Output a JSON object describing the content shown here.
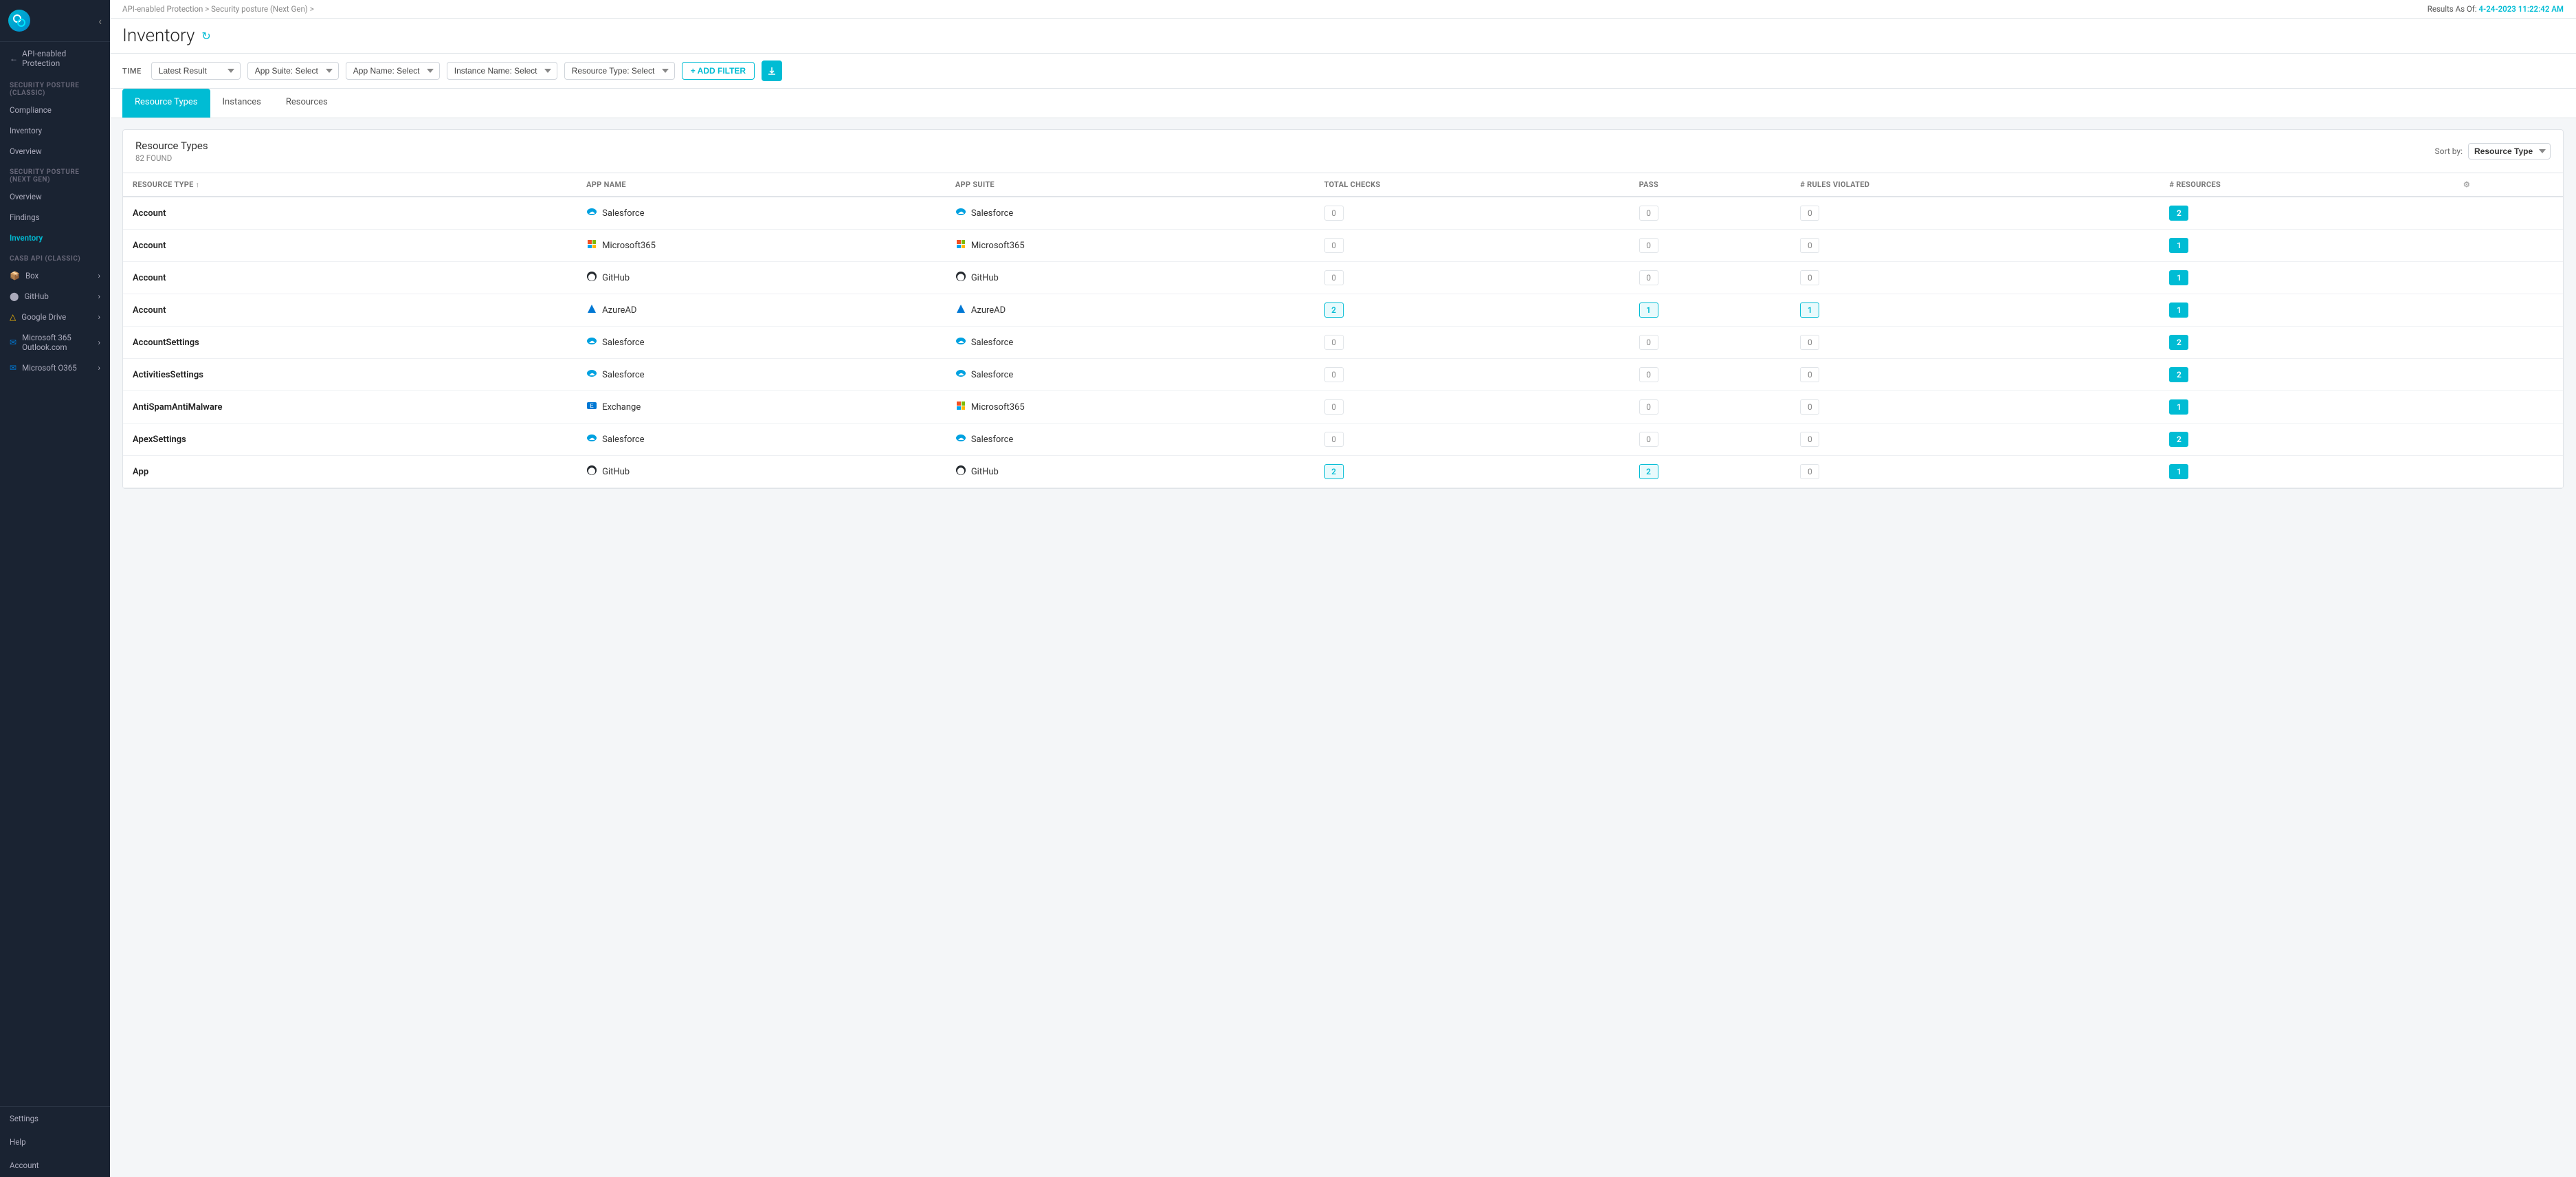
{
  "sidebar": {
    "logo_text": "n",
    "api_protection_title": "API-enabled Protection",
    "back_label": "←",
    "sections": [
      {
        "label": "SECURITY POSTURE (CLASSIC)",
        "items": [
          {
            "id": "compliance",
            "label": "Compliance",
            "active": false
          },
          {
            "id": "inventory-classic",
            "label": "Inventory",
            "active": false
          },
          {
            "id": "overview-classic",
            "label": "Overview",
            "active": false
          }
        ]
      },
      {
        "label": "SECURITY POSTURE (NEXT GEN)",
        "items": [
          {
            "id": "overview-ng",
            "label": "Overview",
            "active": false
          },
          {
            "id": "findings",
            "label": "Findings",
            "active": false
          },
          {
            "id": "inventory-ng",
            "label": "Inventory",
            "active": true
          }
        ]
      },
      {
        "label": "CASB API (CLASSIC)",
        "items": [
          {
            "id": "box",
            "label": "Box",
            "active": false,
            "has_arrow": true
          },
          {
            "id": "github",
            "label": "GitHub",
            "active": false,
            "has_arrow": true
          },
          {
            "id": "google-drive",
            "label": "Google Drive",
            "active": false,
            "has_arrow": true
          },
          {
            "id": "microsoft365-outlook",
            "label": "Microsoft 365 Outlook.com",
            "active": false,
            "has_arrow": true
          },
          {
            "id": "microsoft365",
            "label": "Microsoft O365",
            "active": false,
            "has_arrow": true
          }
        ]
      }
    ],
    "bottom_items": [
      {
        "id": "settings",
        "label": "Settings"
      },
      {
        "id": "help",
        "label": "Help"
      },
      {
        "id": "account",
        "label": "Account"
      }
    ]
  },
  "breadcrumb": {
    "parts": [
      "API-enabled Protection",
      "Security posture (Next Gen)",
      ""
    ]
  },
  "results_as_of": {
    "label": "Results As Of:",
    "value": "4-24-2023 11:22:42 AM"
  },
  "page": {
    "title": "Inventory",
    "time_label": "TIME"
  },
  "filters": {
    "latest_result": {
      "label": "Latest Result",
      "value": "Latest Result"
    },
    "app_suite": {
      "label": "App Suite:",
      "placeholder": "Select"
    },
    "app_name": {
      "label": "App Name:",
      "placeholder": "Select"
    },
    "instance_name": {
      "label": "Instance Name:",
      "placeholder": "Select"
    },
    "resource_type": {
      "label": "Resource Type:",
      "placeholder": "Select"
    },
    "add_filter_label": "+ ADD FILTER",
    "export_icon": "⬇"
  },
  "tabs": [
    {
      "id": "resource-types",
      "label": "Resource Types",
      "active": true
    },
    {
      "id": "instances",
      "label": "Instances",
      "active": false
    },
    {
      "id": "resources",
      "label": "Resources",
      "active": false
    }
  ],
  "resource_types_panel": {
    "title": "Resource Types",
    "count_label": "82 FOUND",
    "sort_label": "Sort by:",
    "sort_value": "Resource Type",
    "columns": [
      {
        "id": "resource-type",
        "label": "RESOURCE TYPE",
        "sortable": true
      },
      {
        "id": "app-name",
        "label": "APP NAME"
      },
      {
        "id": "app-suite",
        "label": "APP SUITE"
      },
      {
        "id": "total-checks",
        "label": "TOTAL CHECKS"
      },
      {
        "id": "pass",
        "label": "PASS"
      },
      {
        "id": "rules-violated",
        "label": "# RULES VIOLATED"
      },
      {
        "id": "resources",
        "label": "# RESOURCES"
      },
      {
        "id": "settings",
        "label": ""
      }
    ],
    "rows": [
      {
        "resource_type": "Account",
        "app_name": "Salesforce",
        "app_name_icon": "salesforce",
        "app_suite": "Salesforce",
        "app_suite_icon": "salesforce",
        "total_checks": "0",
        "pass": "0",
        "rules_violated": "0",
        "resources": "2",
        "resources_highlighted": true
      },
      {
        "resource_type": "Account",
        "app_name": "Microsoft365",
        "app_name_icon": "microsoft",
        "app_suite": "Microsoft365",
        "app_suite_icon": "microsoft",
        "total_checks": "0",
        "pass": "0",
        "rules_violated": "0",
        "resources": "1",
        "resources_highlighted": true
      },
      {
        "resource_type": "Account",
        "app_name": "GitHub",
        "app_name_icon": "github",
        "app_suite": "GitHub",
        "app_suite_icon": "github",
        "total_checks": "0",
        "pass": "0",
        "rules_violated": "0",
        "resources": "1",
        "resources_highlighted": true
      },
      {
        "resource_type": "Account",
        "app_name": "AzureAD",
        "app_name_icon": "azuread",
        "app_suite": "AzureAD",
        "app_suite_icon": "azuread",
        "total_checks": "2",
        "total_checks_highlighted": true,
        "pass": "1",
        "pass_highlighted": true,
        "rules_violated": "1",
        "rules_violated_highlighted": true,
        "resources": "1",
        "resources_highlighted": true
      },
      {
        "resource_type": "AccountSettings",
        "app_name": "Salesforce",
        "app_name_icon": "salesforce",
        "app_suite": "Salesforce",
        "app_suite_icon": "salesforce",
        "total_checks": "0",
        "pass": "0",
        "rules_violated": "0",
        "resources": "2",
        "resources_highlighted": true
      },
      {
        "resource_type": "ActivitiesSettings",
        "app_name": "Salesforce",
        "app_name_icon": "salesforce",
        "app_suite": "Salesforce",
        "app_suite_icon": "salesforce",
        "total_checks": "0",
        "pass": "0",
        "rules_violated": "0",
        "resources": "2",
        "resources_highlighted": true
      },
      {
        "resource_type": "AntiSpamAntiMalware",
        "app_name": "Exchange",
        "app_name_icon": "exchange",
        "app_suite": "Microsoft365",
        "app_suite_icon": "microsoft",
        "total_checks": "0",
        "pass": "0",
        "rules_violated": "0",
        "resources": "1",
        "resources_highlighted": true
      },
      {
        "resource_type": "ApexSettings",
        "app_name": "Salesforce",
        "app_name_icon": "salesforce",
        "app_suite": "Salesforce",
        "app_suite_icon": "salesforce",
        "total_checks": "0",
        "pass": "0",
        "rules_violated": "0",
        "resources": "2",
        "resources_highlighted": true
      },
      {
        "resource_type": "App",
        "app_name": "GitHub",
        "app_name_icon": "github",
        "app_suite": "GitHub",
        "app_suite_icon": "github",
        "total_checks": "2",
        "total_checks_highlighted": true,
        "pass": "2",
        "pass_highlighted": true,
        "rules_violated": "0",
        "resources": "1",
        "resources_highlighted": true
      }
    ]
  },
  "icons": {
    "salesforce": "☁",
    "microsoft": "⬛",
    "github": "⬤",
    "azuread": "▲",
    "exchange": "✉",
    "sort_asc": "↑",
    "gear": "⚙",
    "refresh": "↻",
    "chevron_right": "›",
    "box_icon": "📦",
    "github_icon": "⬤",
    "google_drive_icon": "△",
    "ms_outlook_icon": "✉",
    "ms365_icon": "✉"
  }
}
